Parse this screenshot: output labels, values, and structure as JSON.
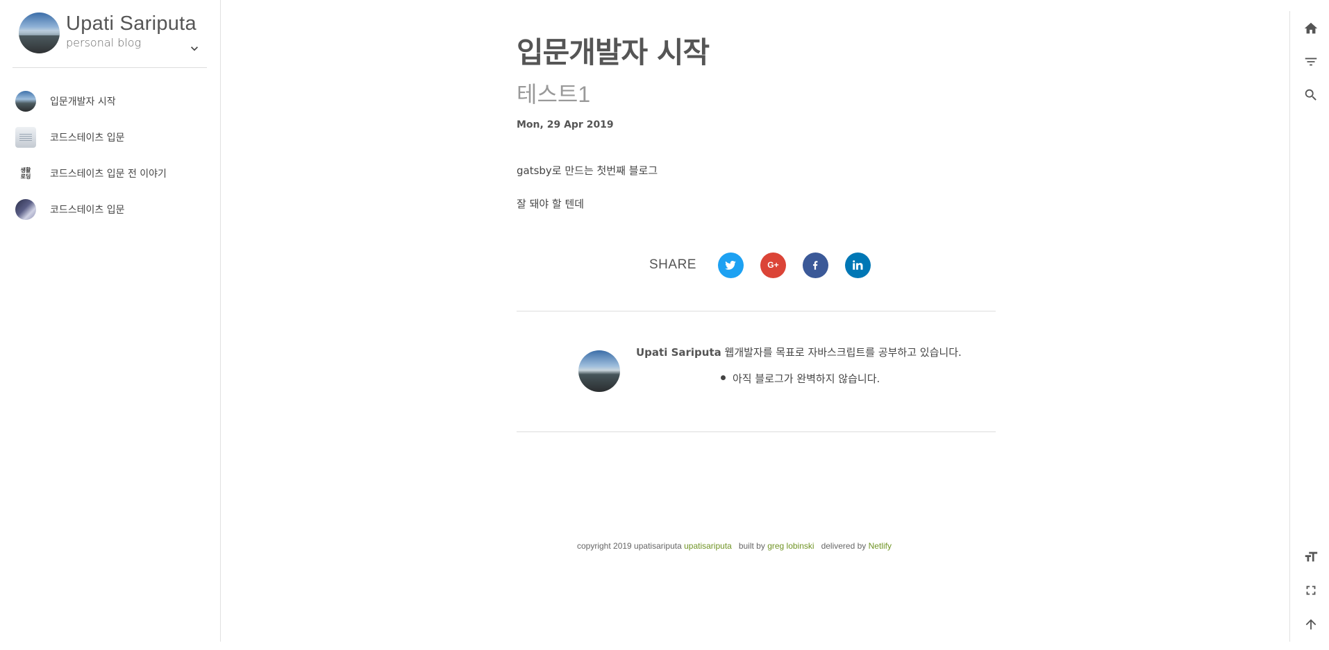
{
  "sidebar": {
    "title": "Upati Sariputa",
    "subtitle": "personal blog",
    "posts": [
      {
        "label": "입문개발자 시작"
      },
      {
        "label": "코드스테이츠 입문"
      },
      {
        "label": "코드스테이츠 입문 전 이야기",
        "thumb_text": "생활\n로딩"
      },
      {
        "label": "코드스테이츠 입문"
      }
    ]
  },
  "post": {
    "title": "입문개발자 시작",
    "subtitle": "테스트1",
    "date": "Mon, 29 Apr 2019",
    "paragraphs": [
      "gatsby로 만드는 첫번째 블로그",
      "잘 돼야 할 텐데"
    ]
  },
  "share": {
    "label": "SHARE",
    "buttons": [
      {
        "icon": "twitter-icon",
        "color": "#1da1f2"
      },
      {
        "icon": "google-plus-icon",
        "color": "#db4437",
        "text": "G+"
      },
      {
        "icon": "facebook-icon",
        "color": "#3b5998"
      },
      {
        "icon": "linkedin-icon",
        "color": "#0077b5"
      }
    ]
  },
  "author": {
    "name": "Upati Sariputa",
    "bio": " 웹개발자를 목표로 자바스크립트를 공부하고 있습니다.",
    "list_item": "아직 블로그가 완벽하지 않습니다."
  },
  "footer": {
    "copyright": "copyright 2019 upatisariputa ",
    "copyright_link": "upatisariputa",
    "built_by": "built by ",
    "built_by_link": "greg lobinski",
    "delivered_by": "delivered by ",
    "delivered_by_link": "Netlify"
  },
  "actions": {
    "top": [
      "home-icon",
      "filter-icon",
      "search-icon"
    ],
    "bottom": [
      "font-size-icon",
      "fullscreen-icon",
      "arrow-up-icon"
    ]
  },
  "colors": {
    "link_green": "#709425",
    "twitter": "#1da1f2",
    "google": "#db4437",
    "facebook": "#3b5998",
    "linkedin": "#0077b5"
  }
}
